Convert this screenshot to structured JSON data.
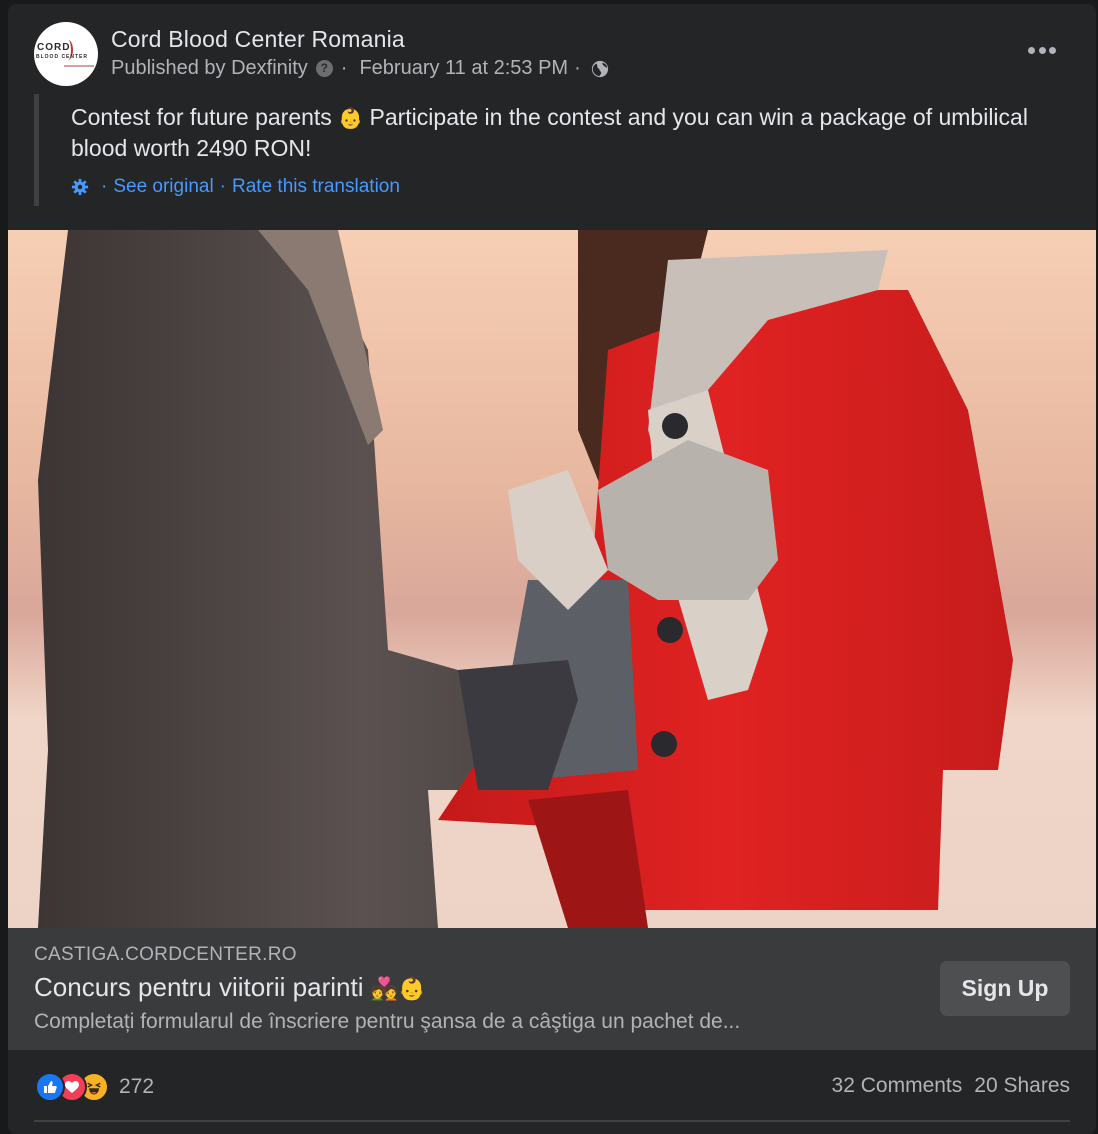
{
  "post": {
    "page_name": "Cord Blood Center Romania",
    "avatar": {
      "logo_line1": "CORD",
      "logo_line2": "BLOOD CENTER"
    },
    "published_by": "Published by Dexfinity",
    "timestamp": "February 11 at 2:53 PM",
    "separator": "·",
    "audience_icon": "globe-icon",
    "help_icon": "question-icon",
    "more_icon": "more-options-icon"
  },
  "translation": {
    "text_part1": "Contest for future parents",
    "emoji": "👶",
    "text_part2": "Participate in the contest and you can win a package of umbilical blood worth 2490 RON!",
    "settings_icon": "gear-icon",
    "see_original": "See original",
    "rate_translation": "Rate this translation",
    "separator": "·"
  },
  "photo": {
    "description": "Couple in winter coats, man in grey coat touching pregnant woman's belly; woman in red coat with knit scarf and mittens"
  },
  "link_card": {
    "domain": "CASTIGA.CORDCENTER.RO",
    "title": "Concurs pentru viitorii parinti",
    "title_emojis": "💑👶",
    "description": "Completați formularul de înscriere pentru şansa de a câştiga un pachet de...",
    "cta_label": "Sign Up"
  },
  "engagement": {
    "reaction_icons": [
      "like-icon",
      "love-icon",
      "haha-icon"
    ],
    "reaction_count": "272",
    "comments": "32 Comments",
    "shares": "20 Shares"
  },
  "colors": {
    "background": "#18191a",
    "card": "#242526",
    "link_card": "#3a3b3c",
    "link_blue": "#4599ff",
    "like_blue": "#1877f2",
    "love_red": "#f33e58",
    "haha_yellow": "#f7b125"
  }
}
